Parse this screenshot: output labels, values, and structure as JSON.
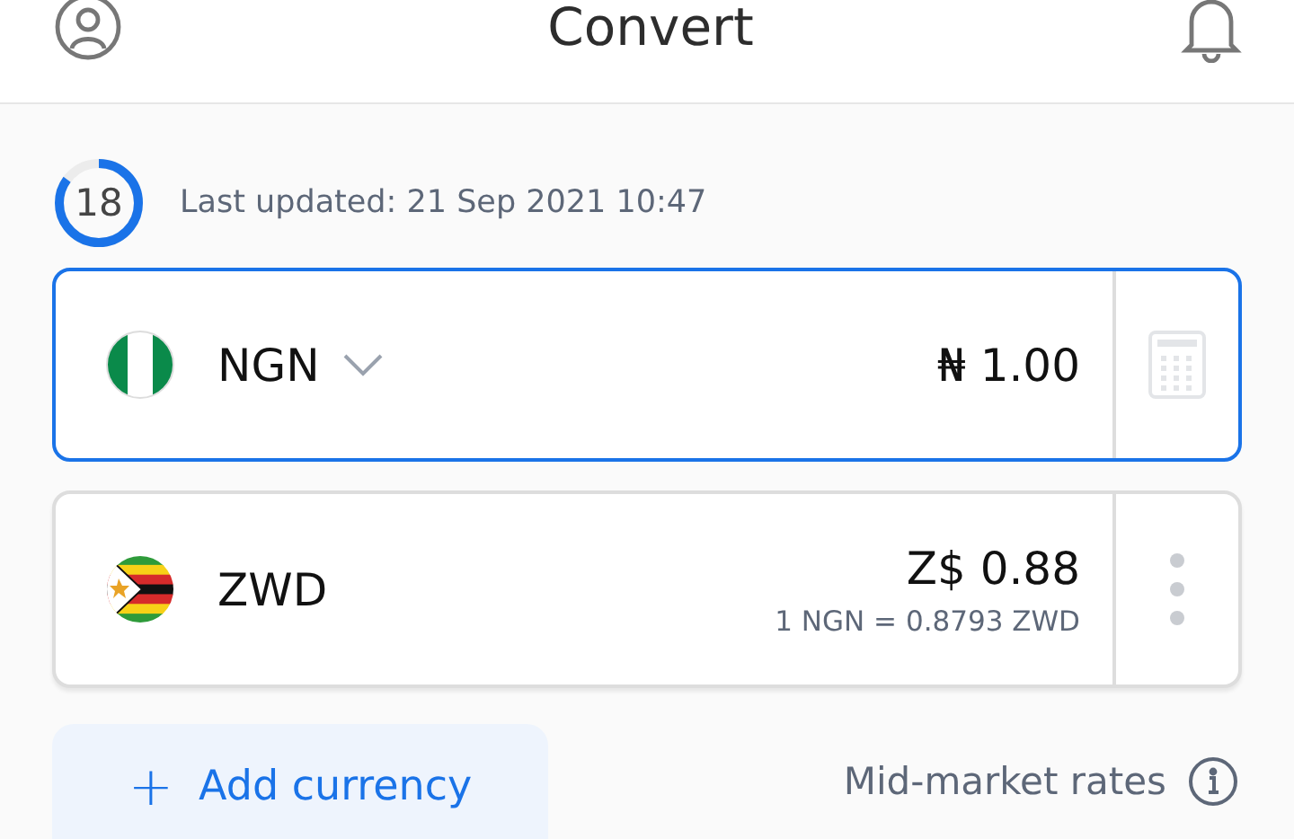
{
  "header": {
    "title": "Convert"
  },
  "update": {
    "countdown": "18",
    "level": 0.85,
    "text": "Last updated: 21 Sep 2021 10:47"
  },
  "currencies": [
    {
      "kind": "source",
      "code": "NGN",
      "flag": {
        "kind": "nigeria"
      },
      "amount": "₦ 1.00",
      "selected": true
    },
    {
      "kind": "target",
      "code": "ZWD",
      "flag": {
        "kind": "zimbabwe"
      },
      "amount": "Z$ 0.88",
      "rate": "1 NGN = 0.8793 ZWD",
      "selected": false
    }
  ],
  "footer": {
    "add_button": "+",
    "add_label": "Add currency",
    "rates_label": "Mid-market rates"
  }
}
